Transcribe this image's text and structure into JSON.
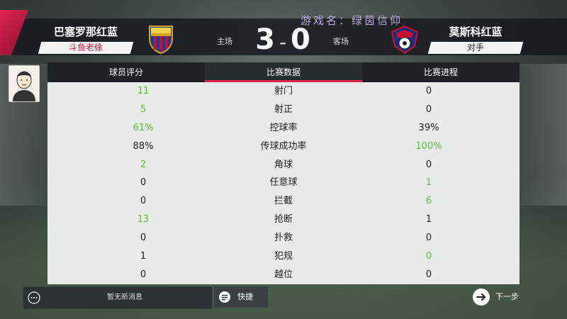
{
  "watermark": "游戏名：绿茵信仰",
  "header": {
    "home": {
      "name": "巴塞罗那红蓝",
      "tag": "斗鱼老徐",
      "side_label": "主场"
    },
    "away": {
      "name": "莫斯科红蓝",
      "tag": "对手",
      "side_label": "客场"
    },
    "score_home": "3",
    "score_sep": "-",
    "score_away": "0"
  },
  "tabs": [
    {
      "label": "球员评分",
      "active": false
    },
    {
      "label": "比赛数据",
      "active": true
    },
    {
      "label": "比赛进程",
      "active": false
    }
  ],
  "stats": [
    {
      "home": "11",
      "label": "射门",
      "away": "0"
    },
    {
      "home": "5",
      "label": "射正",
      "away": "0"
    },
    {
      "home": "61%",
      "label": "控球率",
      "away": "39%"
    },
    {
      "home": "88%",
      "label": "传球成功率",
      "away": "100%"
    },
    {
      "home": "2",
      "label": "角球",
      "away": "0"
    },
    {
      "home": "0",
      "label": "任意球",
      "away": "1"
    },
    {
      "home": "0",
      "label": "拦截",
      "away": "6"
    },
    {
      "home": "13",
      "label": "抢断",
      "away": "1"
    },
    {
      "home": "0",
      "label": "扑救",
      "away": "0"
    },
    {
      "home": "1",
      "label": "犯规",
      "away": "0"
    },
    {
      "home": "0",
      "label": "越位",
      "away": "0"
    }
  ],
  "highlight": {
    "home": [
      0,
      1,
      2,
      4,
      7
    ],
    "away": [
      3,
      5,
      6,
      9
    ]
  },
  "bottom": {
    "message": "暂无新消息",
    "quick": "快捷",
    "next": "下一步"
  },
  "colors": {
    "accent": "#e0234e",
    "highlight": "#5fc036"
  }
}
